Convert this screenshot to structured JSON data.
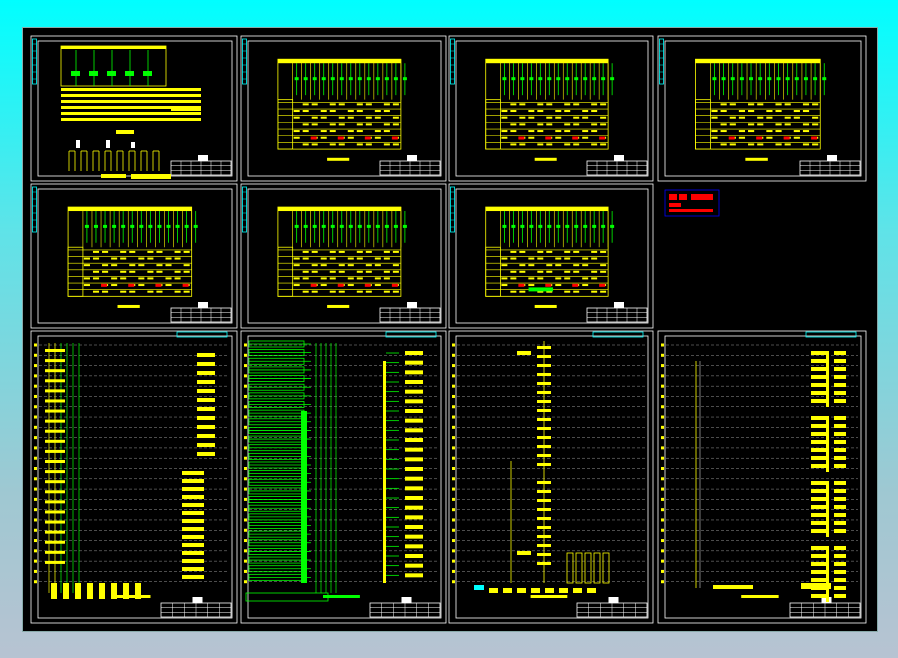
{
  "app": {
    "view": "cad-drawing-viewport"
  },
  "colors": {
    "background_top": "#00ffff",
    "background_bottom": "#b7c3d2",
    "canvas": "#000000",
    "frame": "#ffffff",
    "table": "#ffff00",
    "circuit": "#00ff00",
    "strip": "#00ffff",
    "grid": "#9a9a9a",
    "highlight": "#ff0000",
    "stamp_border": "#0000ff"
  },
  "sheets": [
    {
      "type": "schematic-with-detail",
      "row": 1,
      "col": 1
    },
    {
      "type": "panel-schedule",
      "row": 1,
      "col": 2
    },
    {
      "type": "panel-schedule",
      "row": 1,
      "col": 3
    },
    {
      "type": "panel-schedule",
      "row": 1,
      "col": 4
    },
    {
      "type": "panel-schedule",
      "row": 2,
      "col": 1
    },
    {
      "type": "panel-schedule",
      "row": 2,
      "col": 2
    },
    {
      "type": "panel-schedule",
      "row": 2,
      "col": 3
    },
    {
      "type": "riser-diagram",
      "row": 3,
      "col": 1,
      "accent": "yellow"
    },
    {
      "type": "riser-diagram",
      "row": 3,
      "col": 2,
      "accent": "green"
    },
    {
      "type": "riser-diagram",
      "row": 3,
      "col": 3,
      "accent": "yellow-sparse"
    },
    {
      "type": "riser-diagram",
      "row": 3,
      "col": 4,
      "accent": "yellow-right"
    }
  ],
  "stamp": {
    "icon": "design-stamp-logo"
  }
}
